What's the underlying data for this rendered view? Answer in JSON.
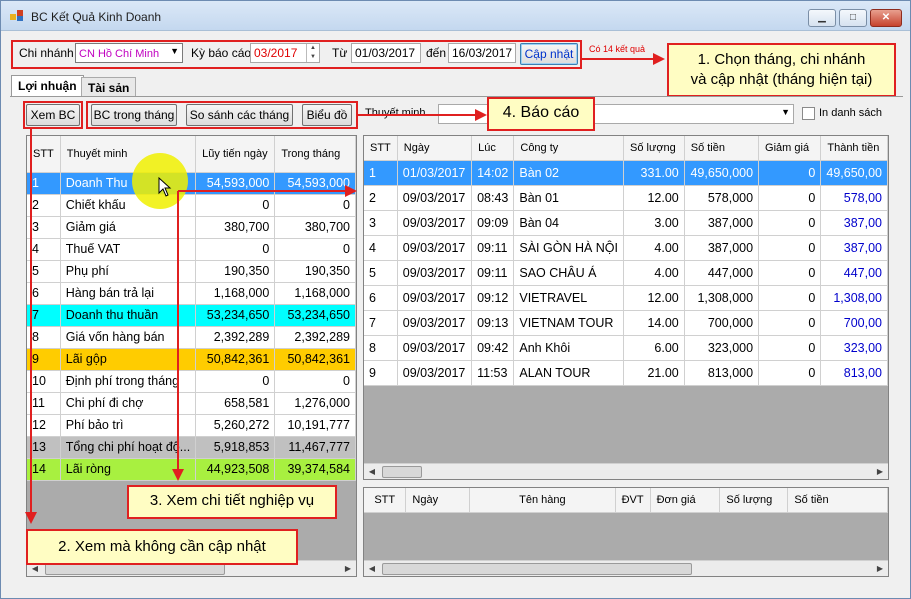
{
  "window": {
    "title": "BC Kết Quả Kinh Doanh",
    "minimize": "▁",
    "maximize": "□",
    "close": "✕"
  },
  "filter": {
    "branch_label": "Chi nhánh",
    "branch_value": "CN Hồ Chí Minh",
    "period_label": "Kỳ báo cáo",
    "period_value": "03/2017",
    "from_label": "Từ",
    "from_value": "01/03/2017",
    "to_label": "đến",
    "to_value": "16/03/2017",
    "update_button": "Cập nhật",
    "result_count": "Có 14 kết quả"
  },
  "tabs": [
    "Lợi nhuận",
    "Tài sản"
  ],
  "toolbar": {
    "view_button": "Xem BC",
    "monthly_button": "BC trong tháng",
    "compare_button": "So sánh các tháng",
    "chart_button": "Biểu đồ",
    "note_label": "Thuyết minh",
    "in_list_label": "In danh sách"
  },
  "callouts": {
    "c1_line1": "1. Chọn tháng, chi nhánh",
    "c1_line2": "và cập nhật (tháng hiện tại)",
    "c2": "2. Xem mà không cần cập nhật",
    "c3": "3. Xem chi tiết nghiệp vụ",
    "c4": "4. Báo cáo"
  },
  "left_grid": {
    "headers": [
      "STT",
      "Thuyết minh",
      "Lũy tiến ngày",
      "Trong tháng"
    ],
    "rows": [
      [
        "1",
        "Doanh Thu",
        "54,593,000",
        "54,593,000"
      ],
      [
        "2",
        "Chiết khấu",
        "0",
        "0"
      ],
      [
        "3",
        "Giảm giá",
        "380,700",
        "380,700"
      ],
      [
        "4",
        "Thuế VAT",
        "0",
        "0"
      ],
      [
        "5",
        "Phụ phí",
        "190,350",
        "190,350"
      ],
      [
        "6",
        "Hàng bán trả lại",
        "1,168,000",
        "1,168,000"
      ],
      [
        "7",
        "Doanh thu thuần",
        "53,234,650",
        "53,234,650"
      ],
      [
        "8",
        "Giá vốn hàng bán",
        "2,392,289",
        "2,392,289"
      ],
      [
        "9",
        "Lãi gộp",
        "50,842,361",
        "50,842,361"
      ],
      [
        "10",
        "Định phí trong tháng",
        "0",
        "0"
      ],
      [
        "11",
        "Chi phí đi chợ",
        "658,581",
        "1,276,000"
      ],
      [
        "12",
        "Phí bảo trì",
        "5,260,272",
        "10,191,777"
      ],
      [
        "13",
        "Tổng chi phí hoạt độ...",
        "5,918,853",
        "11,467,777"
      ],
      [
        "14",
        "Lãi ròng",
        "44,923,508",
        "39,374,584"
      ]
    ],
    "row_colors": [
      "#3399ff",
      "#ffffff",
      "#ffffff",
      "#ffffff",
      "#ffffff",
      "#ffffff",
      "#00ffff",
      "#ffffff",
      "#ffcc00",
      "#ffffff",
      "#ffffff",
      "#ffffff",
      "#c0c0c0",
      "#a8f040"
    ]
  },
  "right_grid": {
    "headers": [
      "STT",
      "Ngày",
      "Lúc",
      "Công ty",
      "Số lượng",
      "Số tiền",
      "Giảm giá",
      "Thành tiền"
    ],
    "rows": [
      [
        "1",
        "01/03/2017",
        "14:02",
        "Bàn 02",
        "331.00",
        "49,650,000",
        "0",
        "49,650,00"
      ],
      [
        "2",
        "09/03/2017",
        "08:43",
        "Bàn 01",
        "12.00",
        "578,000",
        "0",
        "578,00"
      ],
      [
        "3",
        "09/03/2017",
        "09:09",
        "Bàn 04",
        "3.00",
        "387,000",
        "0",
        "387,00"
      ],
      [
        "4",
        "09/03/2017",
        "09:11",
        "SÀI GÒN HÀ NỘI",
        "4.00",
        "387,000",
        "0",
        "387,00"
      ],
      [
        "5",
        "09/03/2017",
        "09:11",
        "SAO CHÂU Á",
        "4.00",
        "447,000",
        "0",
        "447,00"
      ],
      [
        "6",
        "09/03/2017",
        "09:12",
        "VIETRAVEL",
        "12.00",
        "1,308,000",
        "0",
        "1,308,00"
      ],
      [
        "7",
        "09/03/2017",
        "09:13",
        "VIETNAM TOUR",
        "14.00",
        "700,000",
        "0",
        "700,00"
      ],
      [
        "8",
        "09/03/2017",
        "09:42",
        "Anh Khôi",
        "6.00",
        "323,000",
        "0",
        "323,00"
      ],
      [
        "9",
        "09/03/2017",
        "11:53",
        "ALAN TOUR",
        "21.00",
        "813,000",
        "0",
        "813,00"
      ]
    ]
  },
  "detail_grid": {
    "headers": [
      "STT",
      "Ngày",
      "Tên hàng",
      "ĐVT",
      "Đơn giá",
      "Số lượng",
      "Số tiền"
    ]
  },
  "colors": {
    "accent": "#3399ff",
    "annotation_red": "#e02020",
    "callout_bg": "#fffdc3"
  }
}
